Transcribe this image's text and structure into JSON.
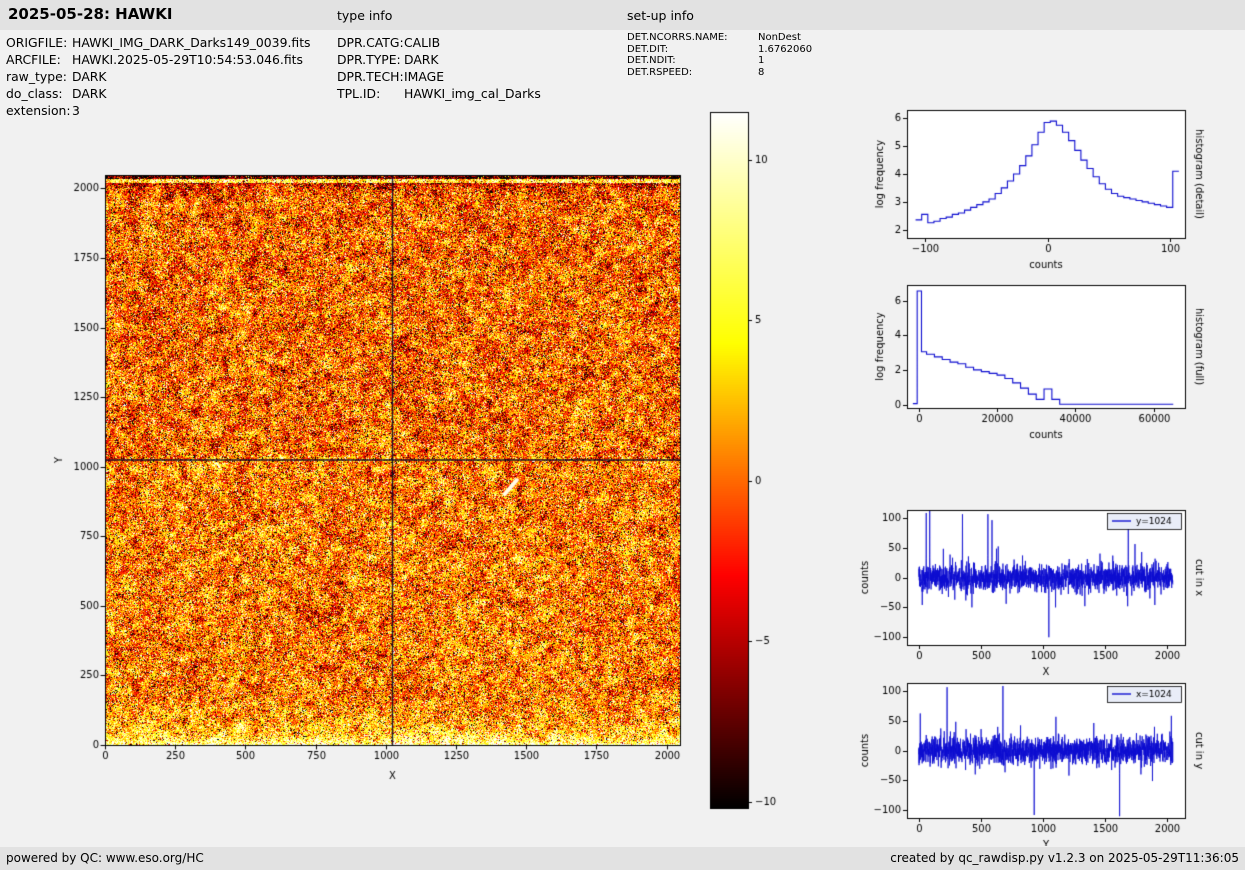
{
  "page": {
    "title": "2025-05-28: HAWKI",
    "type_info_label": "type info",
    "setup_info_label": "set-up info"
  },
  "file_info": [
    {
      "label": "ORIGFILE:",
      "value": "HAWKI_IMG_DARK_Darks149_0039.fits"
    },
    {
      "label": "ARCFILE:",
      "value": "HAWKI.2025-05-29T10:54:53.046.fits"
    },
    {
      "label": "raw_type:",
      "value": "DARK"
    },
    {
      "label": "do_class:",
      "value": "DARK"
    },
    {
      "label": "extension:",
      "value": "3"
    }
  ],
  "type_info": [
    {
      "label": "DPR.CATG:",
      "value": "CALIB"
    },
    {
      "label": "DPR.TYPE:",
      "value": "DARK"
    },
    {
      "label": "DPR.TECH:",
      "value": "IMAGE"
    },
    {
      "label": "TPL.ID:",
      "value": "HAWKI_img_cal_Darks"
    }
  ],
  "setup_info": [
    {
      "label": "DET.NCORRS.NAME:",
      "value": "NonDest"
    },
    {
      "label": "DET.DIT:",
      "value": "1.6762060"
    },
    {
      "label": "DET.NDIT:",
      "value": "1"
    },
    {
      "label": "DET.RSPEED:",
      "value": "8"
    }
  ],
  "footer": {
    "left": "powered by QC: www.eso.org/HC",
    "right": "created by qc_rawdisp.py v1.2.3 on 2025-05-29T11:36:05"
  },
  "colors": {
    "line_blue": "#0d0dd0",
    "band_gray": "#e2e2e2",
    "page_bg": "#f1f1f1",
    "colormap": "hot"
  },
  "chart_data": [
    {
      "id": "raw-image",
      "type": "heatmap",
      "title": "",
      "xlabel": "X",
      "ylabel": "Y",
      "xlim": [
        0,
        2048
      ],
      "ylim": [
        0,
        2048
      ],
      "xticks": [
        0,
        250,
        500,
        750,
        1000,
        1250,
        1500,
        1750,
        2000
      ],
      "yticks": [
        0,
        250,
        500,
        750,
        1000,
        1250,
        1500,
        1750,
        2000
      ],
      "colormap": "hot",
      "value_range": [
        -10.2,
        11.5
      ],
      "noise_sigma": 3.2,
      "mottle_sigma": 2.1,
      "seed": 1234,
      "crosshair_x": 1024,
      "crosshair_y": 1024,
      "bright_bottom_rows": 45,
      "artifact_streak": {
        "x1": 1424,
        "y1": 902,
        "x2": 1467,
        "y2": 952
      },
      "description": "2048x2048 HAWKI dark-frame raw image, hot colormap noise; bright rows at the bottom edge, dark/bright structure at the top edge, crosshair cuts at x=1024 and y=1024, small white cosmic streak near (1445, 930)"
    },
    {
      "id": "colorbar",
      "type": "colorbar",
      "colormap": "hot",
      "range": [
        -10.2,
        11.5
      ],
      "ticks": [
        -10,
        -5,
        0,
        5,
        10
      ]
    },
    {
      "id": "hist-detail",
      "type": "step",
      "xlabel": "counts",
      "ylabel": "log frequency",
      "right_label": "histogram (detail)",
      "xlim": [
        -115,
        112
      ],
      "ylim": [
        1.7,
        6.3
      ],
      "xticks": [
        -100,
        0,
        100
      ],
      "yticks": [
        2,
        3,
        4,
        5,
        6
      ],
      "x": [
        -108,
        -103,
        -98,
        -93,
        -88,
        -83,
        -78,
        -73,
        -68,
        -63,
        -58,
        -53,
        -48,
        -43,
        -38,
        -33,
        -28,
        -23,
        -18,
        -13,
        -8,
        -3,
        2,
        7,
        12,
        17,
        22,
        27,
        32,
        37,
        42,
        47,
        52,
        57,
        62,
        67,
        72,
        77,
        82,
        87,
        92,
        97,
        102,
        107
      ],
      "y": [
        2.35,
        2.55,
        2.25,
        2.3,
        2.4,
        2.45,
        2.55,
        2.6,
        2.7,
        2.8,
        2.9,
        3.0,
        3.1,
        3.3,
        3.5,
        3.75,
        4.0,
        4.3,
        4.65,
        5.05,
        5.5,
        5.85,
        5.9,
        5.75,
        5.5,
        5.2,
        4.85,
        4.5,
        4.2,
        3.9,
        3.65,
        3.45,
        3.3,
        3.2,
        3.15,
        3.1,
        3.05,
        3.0,
        2.95,
        2.9,
        2.85,
        2.8,
        4.1
      ]
    },
    {
      "id": "hist-full",
      "type": "step",
      "xlabel": "counts",
      "ylabel": "log frequency",
      "right_label": "histogram (full)",
      "xlim": [
        -3000,
        68000
      ],
      "ylim": [
        -0.2,
        6.9
      ],
      "xticks": [
        0,
        20000,
        40000,
        60000
      ],
      "yticks": [
        0,
        2,
        4,
        6
      ],
      "x": [
        -1500,
        -400,
        700,
        2000,
        4000,
        6000,
        8000,
        10000,
        12000,
        14000,
        16000,
        18000,
        20000,
        22000,
        24000,
        26000,
        28000,
        30000,
        32000,
        34000,
        36000,
        65000
      ],
      "y": [
        0.05,
        6.55,
        3.05,
        2.9,
        2.75,
        2.6,
        2.45,
        2.35,
        2.15,
        2.0,
        1.9,
        1.8,
        1.7,
        1.5,
        1.25,
        0.95,
        0.6,
        0.3,
        0.9,
        0.3,
        0.02
      ]
    },
    {
      "id": "cut-x",
      "type": "cut",
      "xlabel": "X",
      "ylabel": "counts",
      "right_label": "cut in x",
      "legend": "y=1024",
      "xlim": [
        -95,
        2145
      ],
      "ylim": [
        -113,
        113
      ],
      "xticks": [
        0,
        500,
        1000,
        1500,
        2000
      ],
      "yticks": [
        -100,
        -50,
        0,
        50,
        100
      ],
      "n": 2048,
      "noise_sigma": 11,
      "seed": 77,
      "spikes": [
        [
          28,
          -46
        ],
        [
          60,
          108
        ],
        [
          88,
          112
        ],
        [
          198,
          48
        ],
        [
          352,
          106
        ],
        [
          428,
          -50
        ],
        [
          557,
          106
        ],
        [
          590,
          96
        ],
        [
          640,
          52
        ],
        [
          704,
          -44
        ],
        [
          1048,
          -100
        ],
        [
          1102,
          -50
        ],
        [
          1338,
          -48
        ],
        [
          1460,
          40
        ],
        [
          1688,
          102
        ],
        [
          1742,
          56
        ],
        [
          1902,
          -46
        ]
      ]
    },
    {
      "id": "cut-y",
      "type": "cut",
      "xlabel": "Y",
      "ylabel": "counts",
      "right_label": "cut in y",
      "legend": "x=1024",
      "xlim": [
        -95,
        2145
      ],
      "ylim": [
        -113,
        113
      ],
      "xticks": [
        0,
        500,
        1000,
        1500,
        2000
      ],
      "yticks": [
        -100,
        -50,
        0,
        50,
        100
      ],
      "n": 2048,
      "noise_sigma": 11,
      "seed": 913,
      "spikes": [
        [
          12,
          62
        ],
        [
          228,
          106
        ],
        [
          298,
          48
        ],
        [
          455,
          -40
        ],
        [
          678,
          108
        ],
        [
          820,
          42
        ],
        [
          930,
          -108
        ],
        [
          1210,
          -42
        ],
        [
          1410,
          46
        ],
        [
          1618,
          -110
        ],
        [
          1790,
          -40
        ],
        [
          2035,
          58
        ]
      ]
    }
  ]
}
